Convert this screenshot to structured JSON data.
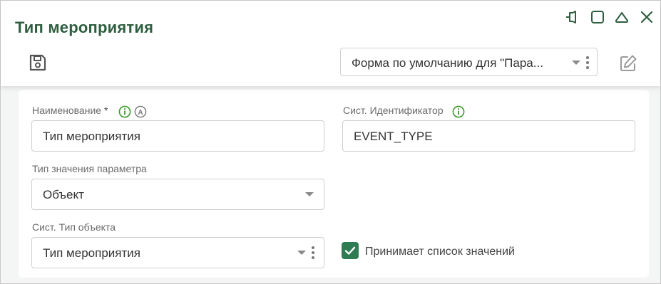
{
  "window": {
    "title": "Тип мероприятия",
    "controls": [
      "pin-icon",
      "maximize-icon",
      "collapse-icon",
      "close-icon"
    ]
  },
  "toolbar": {
    "save_icon": "save-icon",
    "form_select_value": "Форма по умолчанию для \"Пара...",
    "edit_icon": "edit-icon"
  },
  "form": {
    "name": {
      "label": "Наименование",
      "required_mark": "*",
      "value": "Тип мероприятия",
      "auto_badge": "A"
    },
    "sys_id": {
      "label": "Сист. Идентификатор",
      "value": "EVENT_TYPE"
    },
    "value_type": {
      "label": "Тип значения параметра",
      "value": "Объект"
    },
    "object_type": {
      "label": "Сист. Тип объекта",
      "value": "Тип мероприятия"
    },
    "accepts_list": {
      "label": "Принимает список значений",
      "checked": true
    }
  },
  "colors": {
    "accent": "#2e7d52",
    "title": "#2e5e3f",
    "info": "#3f9b2f"
  }
}
